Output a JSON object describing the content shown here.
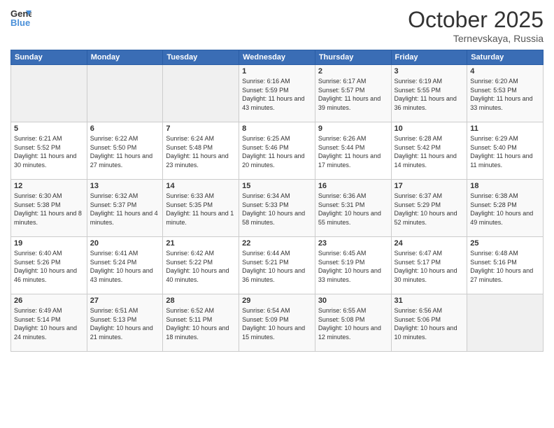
{
  "header": {
    "logo_line1": "General",
    "logo_line2": "Blue",
    "month": "October 2025",
    "location": "Ternevskaya, Russia"
  },
  "days_of_week": [
    "Sunday",
    "Monday",
    "Tuesday",
    "Wednesday",
    "Thursday",
    "Friday",
    "Saturday"
  ],
  "weeks": [
    [
      {
        "num": "",
        "sunrise": "",
        "sunset": "",
        "daylight": "",
        "empty": true
      },
      {
        "num": "",
        "sunrise": "",
        "sunset": "",
        "daylight": "",
        "empty": true
      },
      {
        "num": "",
        "sunrise": "",
        "sunset": "",
        "daylight": "",
        "empty": true
      },
      {
        "num": "1",
        "sunrise": "Sunrise: 6:16 AM",
        "sunset": "Sunset: 5:59 PM",
        "daylight": "Daylight: 11 hours and 43 minutes."
      },
      {
        "num": "2",
        "sunrise": "Sunrise: 6:17 AM",
        "sunset": "Sunset: 5:57 PM",
        "daylight": "Daylight: 11 hours and 39 minutes."
      },
      {
        "num": "3",
        "sunrise": "Sunrise: 6:19 AM",
        "sunset": "Sunset: 5:55 PM",
        "daylight": "Daylight: 11 hours and 36 minutes."
      },
      {
        "num": "4",
        "sunrise": "Sunrise: 6:20 AM",
        "sunset": "Sunset: 5:53 PM",
        "daylight": "Daylight: 11 hours and 33 minutes."
      }
    ],
    [
      {
        "num": "5",
        "sunrise": "Sunrise: 6:21 AM",
        "sunset": "Sunset: 5:52 PM",
        "daylight": "Daylight: 11 hours and 30 minutes."
      },
      {
        "num": "6",
        "sunrise": "Sunrise: 6:22 AM",
        "sunset": "Sunset: 5:50 PM",
        "daylight": "Daylight: 11 hours and 27 minutes."
      },
      {
        "num": "7",
        "sunrise": "Sunrise: 6:24 AM",
        "sunset": "Sunset: 5:48 PM",
        "daylight": "Daylight: 11 hours and 23 minutes."
      },
      {
        "num": "8",
        "sunrise": "Sunrise: 6:25 AM",
        "sunset": "Sunset: 5:46 PM",
        "daylight": "Daylight: 11 hours and 20 minutes."
      },
      {
        "num": "9",
        "sunrise": "Sunrise: 6:26 AM",
        "sunset": "Sunset: 5:44 PM",
        "daylight": "Daylight: 11 hours and 17 minutes."
      },
      {
        "num": "10",
        "sunrise": "Sunrise: 6:28 AM",
        "sunset": "Sunset: 5:42 PM",
        "daylight": "Daylight: 11 hours and 14 minutes."
      },
      {
        "num": "11",
        "sunrise": "Sunrise: 6:29 AM",
        "sunset": "Sunset: 5:40 PM",
        "daylight": "Daylight: 11 hours and 11 minutes."
      }
    ],
    [
      {
        "num": "12",
        "sunrise": "Sunrise: 6:30 AM",
        "sunset": "Sunset: 5:38 PM",
        "daylight": "Daylight: 11 hours and 8 minutes."
      },
      {
        "num": "13",
        "sunrise": "Sunrise: 6:32 AM",
        "sunset": "Sunset: 5:37 PM",
        "daylight": "Daylight: 11 hours and 4 minutes."
      },
      {
        "num": "14",
        "sunrise": "Sunrise: 6:33 AM",
        "sunset": "Sunset: 5:35 PM",
        "daylight": "Daylight: 11 hours and 1 minute."
      },
      {
        "num": "15",
        "sunrise": "Sunrise: 6:34 AM",
        "sunset": "Sunset: 5:33 PM",
        "daylight": "Daylight: 10 hours and 58 minutes."
      },
      {
        "num": "16",
        "sunrise": "Sunrise: 6:36 AM",
        "sunset": "Sunset: 5:31 PM",
        "daylight": "Daylight: 10 hours and 55 minutes."
      },
      {
        "num": "17",
        "sunrise": "Sunrise: 6:37 AM",
        "sunset": "Sunset: 5:29 PM",
        "daylight": "Daylight: 10 hours and 52 minutes."
      },
      {
        "num": "18",
        "sunrise": "Sunrise: 6:38 AM",
        "sunset": "Sunset: 5:28 PM",
        "daylight": "Daylight: 10 hours and 49 minutes."
      }
    ],
    [
      {
        "num": "19",
        "sunrise": "Sunrise: 6:40 AM",
        "sunset": "Sunset: 5:26 PM",
        "daylight": "Daylight: 10 hours and 46 minutes."
      },
      {
        "num": "20",
        "sunrise": "Sunrise: 6:41 AM",
        "sunset": "Sunset: 5:24 PM",
        "daylight": "Daylight: 10 hours and 43 minutes."
      },
      {
        "num": "21",
        "sunrise": "Sunrise: 6:42 AM",
        "sunset": "Sunset: 5:22 PM",
        "daylight": "Daylight: 10 hours and 40 minutes."
      },
      {
        "num": "22",
        "sunrise": "Sunrise: 6:44 AM",
        "sunset": "Sunset: 5:21 PM",
        "daylight": "Daylight: 10 hours and 36 minutes."
      },
      {
        "num": "23",
        "sunrise": "Sunrise: 6:45 AM",
        "sunset": "Sunset: 5:19 PM",
        "daylight": "Daylight: 10 hours and 33 minutes."
      },
      {
        "num": "24",
        "sunrise": "Sunrise: 6:47 AM",
        "sunset": "Sunset: 5:17 PM",
        "daylight": "Daylight: 10 hours and 30 minutes."
      },
      {
        "num": "25",
        "sunrise": "Sunrise: 6:48 AM",
        "sunset": "Sunset: 5:16 PM",
        "daylight": "Daylight: 10 hours and 27 minutes."
      }
    ],
    [
      {
        "num": "26",
        "sunrise": "Sunrise: 6:49 AM",
        "sunset": "Sunset: 5:14 PM",
        "daylight": "Daylight: 10 hours and 24 minutes."
      },
      {
        "num": "27",
        "sunrise": "Sunrise: 6:51 AM",
        "sunset": "Sunset: 5:13 PM",
        "daylight": "Daylight: 10 hours and 21 minutes."
      },
      {
        "num": "28",
        "sunrise": "Sunrise: 6:52 AM",
        "sunset": "Sunset: 5:11 PM",
        "daylight": "Daylight: 10 hours and 18 minutes."
      },
      {
        "num": "29",
        "sunrise": "Sunrise: 6:54 AM",
        "sunset": "Sunset: 5:09 PM",
        "daylight": "Daylight: 10 hours and 15 minutes."
      },
      {
        "num": "30",
        "sunrise": "Sunrise: 6:55 AM",
        "sunset": "Sunset: 5:08 PM",
        "daylight": "Daylight: 10 hours and 12 minutes."
      },
      {
        "num": "31",
        "sunrise": "Sunrise: 6:56 AM",
        "sunset": "Sunset: 5:06 PM",
        "daylight": "Daylight: 10 hours and 10 minutes."
      },
      {
        "num": "",
        "sunrise": "",
        "sunset": "",
        "daylight": "",
        "empty": true
      }
    ]
  ]
}
